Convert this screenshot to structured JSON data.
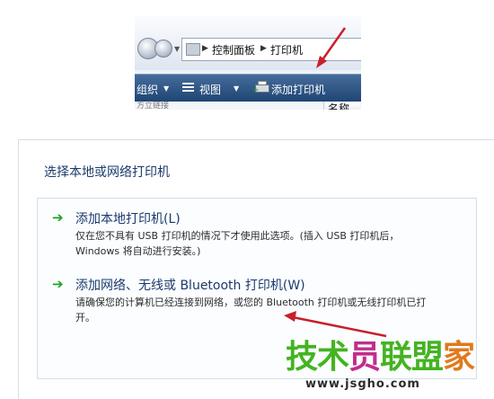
{
  "explorer": {
    "breadcrumb": [
      "控制面板",
      "打印机"
    ],
    "toolbar": {
      "organize_label": "组织",
      "view_label": "视图",
      "add_printer_label": "添加打印机"
    },
    "faded_text": "方立链接",
    "column_header": "名称"
  },
  "wizard": {
    "title": "选择本地或网络打印机",
    "options": [
      {
        "title": "添加本地打印机(L)",
        "description_line1": "仅在您不具有 USB 打印机的情况下才使用此选项。(插入 USB 打印机后，",
        "description_line2": "Windows 将自动进行安装。)"
      },
      {
        "title": "添加网络、无线或 Bluetooth 打印机(W)",
        "description_line1": "请确保您的计算机已经连接到网络，或您的 Bluetooth 打印机或无线打印机已打",
        "description_line2": "开。"
      }
    ]
  },
  "watermark": {
    "logo_part1": "技术",
    "logo_part2": "员",
    "logo_part3": "联盟",
    "logo_part4": "家",
    "url": "www.jsgho.com"
  },
  "colors": {
    "command_bar": "#2a5284",
    "heading_blue": "#1b3a6b",
    "green_arrow": "#1ea21e",
    "annotation_red": "#c8202a"
  }
}
